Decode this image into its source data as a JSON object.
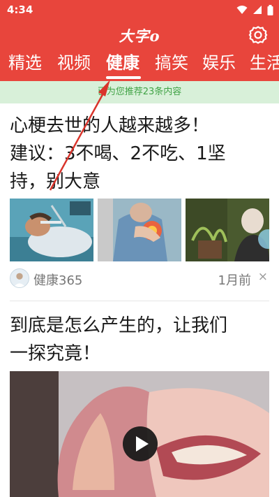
{
  "status_bar": {
    "time": "4:34"
  },
  "app": {
    "logo_text": "大字",
    "logo_suffix": "o"
  },
  "tabs": [
    {
      "label": "精选"
    },
    {
      "label": "视频"
    },
    {
      "label": "健康",
      "active": true
    },
    {
      "label": "搞笑"
    },
    {
      "label": "娱乐"
    },
    {
      "label": "生活"
    }
  ],
  "notice": {
    "text": "已为您推荐23条内容"
  },
  "articles": [
    {
      "title": "心梗去世的人越来越多！建议：3不喝、2不吃、1坚持，别大意",
      "title_lines": [
        "心梗去世的人越来越多！",
        "建议：3不喝、2不吃、1坚",
        "持，别大意"
      ],
      "source": "健康365",
      "time": "1月前",
      "dismiss": "×"
    },
    {
      "title": "到底是怎么产生的，让我们一探究竟！",
      "title_lines": [
        "到底是怎么产生的，让我们",
        "一探究竟！"
      ]
    }
  ],
  "colors": {
    "header_red": "#e8453c",
    "notice_bg": "#d8f0d9",
    "notice_text": "#41a346",
    "annotation_arrow": "#d9342b"
  },
  "icons": [
    "wifi-icon",
    "signal-icon",
    "battery-icon",
    "settings-gear-icon",
    "play-icon",
    "close-icon"
  ]
}
